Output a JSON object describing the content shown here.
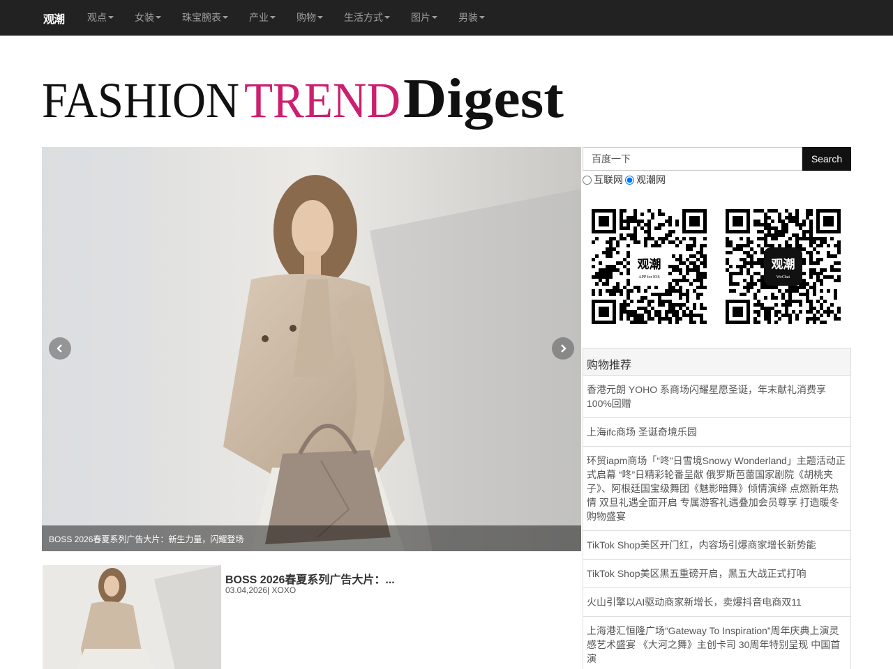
{
  "nav": {
    "logo": "观潮",
    "items": [
      {
        "label": "观点"
      },
      {
        "label": "女装"
      },
      {
        "label": "珠宝腕表"
      },
      {
        "label": "产业"
      },
      {
        "label": "购物"
      },
      {
        "label": "生活方式"
      },
      {
        "label": "图片"
      },
      {
        "label": "男装"
      }
    ]
  },
  "masthead": {
    "word1": "FASHION",
    "word2": "TREND",
    "word3": "Digest",
    "colors": {
      "word1": "#111111",
      "word2": "#cc1f6f",
      "word3": "#111111"
    }
  },
  "carousel": {
    "caption": "BOSS 2026春夏系列广告大片：新生力量，闪耀登场",
    "prev_icon": "chevron-left-icon",
    "next_icon": "chevron-right-icon"
  },
  "article": {
    "title": "BOSS 2026春夏系列广告大片：...",
    "meta": "03.04,2026| XOXO"
  },
  "search": {
    "placeholder": "百度一下",
    "button": "Search",
    "option1": "互联网",
    "option2": "观潮网",
    "selected": "观潮网"
  },
  "qr": {
    "ios": {
      "logo": "观潮",
      "sub": "APP for IOS"
    },
    "wechat": {
      "logo": "观潮",
      "sub": "WeChat"
    }
  },
  "shopping": {
    "heading": "购物推荐",
    "items": [
      "香港元朗 YOHO 系商场闪耀星愿圣诞，年末献礼消费享100%回赠",
      "上海ifc商场 圣诞奇境乐园",
      "环贸iapm商场「“咚”日雪境Snowy Wonderland」主题活动正式启幕 “咚”日精彩轮番呈献 俄罗斯芭蕾国家剧院《胡桃夹子》、阿根廷国宝级舞团《魅影暗舞》倾情演绎 点燃新年热情 双旦礼遇全面开启 专属游客礼遇叠加会员尊享 打造暖冬购物盛宴",
      "TikTok Shop美区开门红，内容场引爆商家增长新势能",
      "TikTok Shop美区黑五重磅开启，黑五大战正式打响",
      "火山引擎以AI驱动商家新增长，卖爆抖音电商双11",
      "上海港汇恒隆广场“Gateway To Inspiration”周年庆典上演灵感艺术盛宴 《大河之舞》主创卡司 30周年特别呈现 中国首演"
    ]
  }
}
